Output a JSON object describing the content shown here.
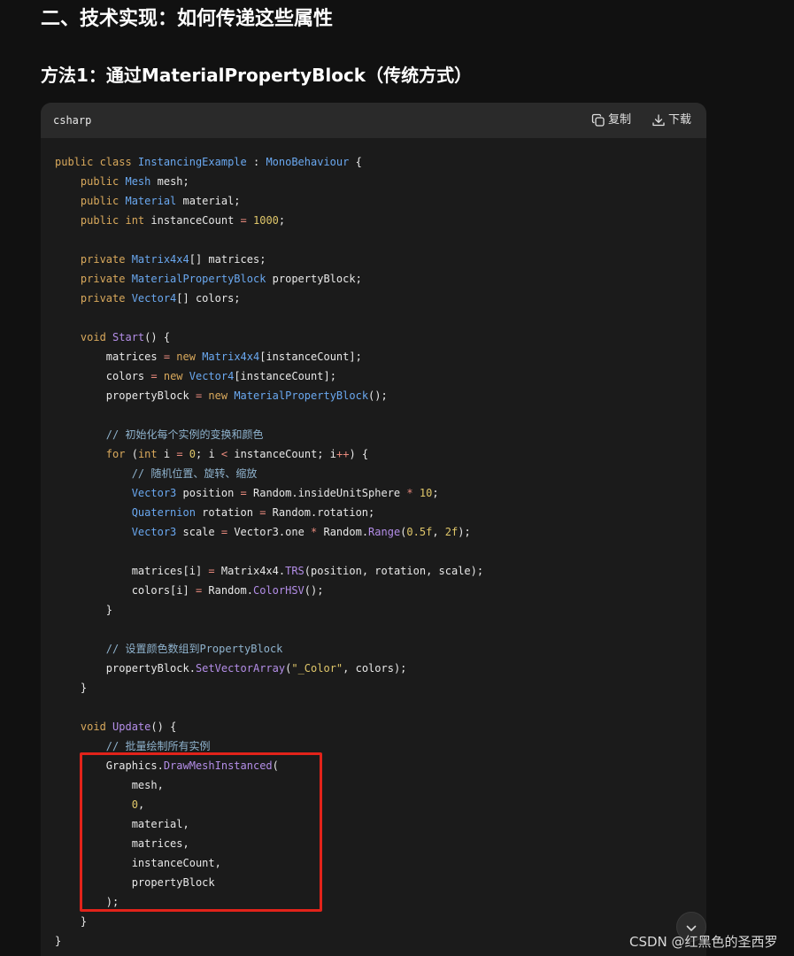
{
  "headings": {
    "h2": "二、技术实现：如何传递这些属性",
    "h3": "方法1：通过MaterialPropertyBlock（传统方式）"
  },
  "code_block": {
    "language": "csharp",
    "copy_label": "复制",
    "download_label": "下载",
    "copy_icon": "copy-icon",
    "download_icon": "download-icon",
    "scroll_icon": "chevron-down-icon",
    "lines": [
      [
        [
          "kw",
          "public class "
        ],
        [
          "type",
          "InstancingExample"
        ],
        [
          "plain",
          " : "
        ],
        [
          "type",
          "MonoBehaviour"
        ],
        [
          "plain",
          " {"
        ]
      ],
      [
        [
          "plain",
          "    "
        ],
        [
          "kw",
          "public "
        ],
        [
          "type",
          "Mesh"
        ],
        [
          "plain",
          " mesh;"
        ]
      ],
      [
        [
          "plain",
          "    "
        ],
        [
          "kw",
          "public "
        ],
        [
          "type",
          "Material"
        ],
        [
          "plain",
          " material;"
        ]
      ],
      [
        [
          "plain",
          "    "
        ],
        [
          "kw",
          "public int"
        ],
        [
          "plain",
          " instanceCount "
        ],
        [
          "op",
          "="
        ],
        [
          "plain",
          " "
        ],
        [
          "num",
          "1000"
        ],
        [
          "plain",
          ";"
        ]
      ],
      [],
      [
        [
          "plain",
          "    "
        ],
        [
          "kw",
          "private "
        ],
        [
          "type",
          "Matrix4x4"
        ],
        [
          "plain",
          "[] matrices;"
        ]
      ],
      [
        [
          "plain",
          "    "
        ],
        [
          "kw",
          "private "
        ],
        [
          "type",
          "MaterialPropertyBlock"
        ],
        [
          "plain",
          " propertyBlock;"
        ]
      ],
      [
        [
          "plain",
          "    "
        ],
        [
          "kw",
          "private "
        ],
        [
          "type",
          "Vector4"
        ],
        [
          "plain",
          "[] colors;"
        ]
      ],
      [],
      [
        [
          "plain",
          "    "
        ],
        [
          "kw",
          "void "
        ],
        [
          "fn",
          "Start"
        ],
        [
          "plain",
          "() {"
        ]
      ],
      [
        [
          "plain",
          "        matrices "
        ],
        [
          "op",
          "="
        ],
        [
          "plain",
          " "
        ],
        [
          "kw",
          "new "
        ],
        [
          "type",
          "Matrix4x4"
        ],
        [
          "plain",
          "[instanceCount];"
        ]
      ],
      [
        [
          "plain",
          "        colors "
        ],
        [
          "op",
          "="
        ],
        [
          "plain",
          " "
        ],
        [
          "kw",
          "new "
        ],
        [
          "type",
          "Vector4"
        ],
        [
          "plain",
          "[instanceCount];"
        ]
      ],
      [
        [
          "plain",
          "        propertyBlock "
        ],
        [
          "op",
          "="
        ],
        [
          "plain",
          " "
        ],
        [
          "kw",
          "new "
        ],
        [
          "type",
          "MaterialPropertyBlock"
        ],
        [
          "plain",
          "();"
        ]
      ],
      [],
      [
        [
          "plain",
          "        "
        ],
        [
          "cm",
          "// 初始化每个实例的变换和颜色"
        ]
      ],
      [
        [
          "plain",
          "        "
        ],
        [
          "kw",
          "for"
        ],
        [
          "plain",
          " ("
        ],
        [
          "kw",
          "int"
        ],
        [
          "plain",
          " i "
        ],
        [
          "op",
          "="
        ],
        [
          "plain",
          " "
        ],
        [
          "num",
          "0"
        ],
        [
          "plain",
          "; i "
        ],
        [
          "op",
          "<"
        ],
        [
          "plain",
          " instanceCount; i"
        ],
        [
          "op",
          "++"
        ],
        [
          "plain",
          ") {"
        ]
      ],
      [
        [
          "plain",
          "            "
        ],
        [
          "cm",
          "// 随机位置、旋转、缩放"
        ]
      ],
      [
        [
          "plain",
          "            "
        ],
        [
          "type",
          "Vector3"
        ],
        [
          "plain",
          " position "
        ],
        [
          "op",
          "="
        ],
        [
          "plain",
          " Random.insideUnitSphere "
        ],
        [
          "op",
          "*"
        ],
        [
          "plain",
          " "
        ],
        [
          "num",
          "10"
        ],
        [
          "plain",
          ";"
        ]
      ],
      [
        [
          "plain",
          "            "
        ],
        [
          "type",
          "Quaternion"
        ],
        [
          "plain",
          " rotation "
        ],
        [
          "op",
          "="
        ],
        [
          "plain",
          " Random.rotation;"
        ]
      ],
      [
        [
          "plain",
          "            "
        ],
        [
          "type",
          "Vector3"
        ],
        [
          "plain",
          " scale "
        ],
        [
          "op",
          "="
        ],
        [
          "plain",
          " Vector3.one "
        ],
        [
          "op",
          "*"
        ],
        [
          "plain",
          " Random."
        ],
        [
          "fn",
          "Range"
        ],
        [
          "plain",
          "("
        ],
        [
          "num",
          "0.5f"
        ],
        [
          "plain",
          ", "
        ],
        [
          "num",
          "2f"
        ],
        [
          "plain",
          ");"
        ]
      ],
      [],
      [
        [
          "plain",
          "            matrices[i] "
        ],
        [
          "op",
          "="
        ],
        [
          "plain",
          " Matrix4x4."
        ],
        [
          "fn",
          "TRS"
        ],
        [
          "plain",
          "(position, rotation, scale);"
        ]
      ],
      [
        [
          "plain",
          "            colors[i] "
        ],
        [
          "op",
          "="
        ],
        [
          "plain",
          " Random."
        ],
        [
          "fn",
          "ColorHSV"
        ],
        [
          "plain",
          "();"
        ]
      ],
      [
        [
          "plain",
          "        }"
        ]
      ],
      [],
      [
        [
          "plain",
          "        "
        ],
        [
          "cm",
          "// 设置颜色数组到PropertyBlock"
        ]
      ],
      [
        [
          "plain",
          "        propertyBlock."
        ],
        [
          "fn",
          "SetVectorArray"
        ],
        [
          "plain",
          "("
        ],
        [
          "str",
          "\"_Color\""
        ],
        [
          "plain",
          ", colors);"
        ]
      ],
      [
        [
          "plain",
          "    }"
        ]
      ],
      [],
      [
        [
          "plain",
          "    "
        ],
        [
          "kw",
          "void "
        ],
        [
          "fn",
          "Update"
        ],
        [
          "plain",
          "() {"
        ]
      ],
      [
        [
          "plain",
          "        "
        ],
        [
          "cm",
          "// 批量绘制所有实例"
        ]
      ],
      [
        [
          "plain",
          "        Graphics."
        ],
        [
          "fn",
          "DrawMeshInstanced"
        ],
        [
          "plain",
          "("
        ]
      ],
      [
        [
          "plain",
          "            mesh,"
        ]
      ],
      [
        [
          "plain",
          "            "
        ],
        [
          "num",
          "0"
        ],
        [
          "plain",
          ","
        ]
      ],
      [
        [
          "plain",
          "            material,"
        ]
      ],
      [
        [
          "plain",
          "            matrices,"
        ]
      ],
      [
        [
          "plain",
          "            instanceCount,"
        ]
      ],
      [
        [
          "plain",
          "            propertyBlock"
        ]
      ],
      [
        [
          "plain",
          "        );"
        ]
      ],
      [
        [
          "plain",
          "    }"
        ]
      ],
      [
        [
          "plain",
          "}"
        ]
      ]
    ]
  },
  "colors": {
    "page_bg": "#111111",
    "code_bg": "#1b1b1b",
    "header_bg": "#2a2a2a",
    "keyword": "#d9a95c",
    "type": "#6aa8f0",
    "function": "#b48ee8",
    "number": "#e0c76a",
    "comment": "#8fb3ce",
    "operator": "#e88a7d",
    "highlight_border": "#e2231a"
  },
  "watermark": "CSDN @红黑色的圣西罗"
}
